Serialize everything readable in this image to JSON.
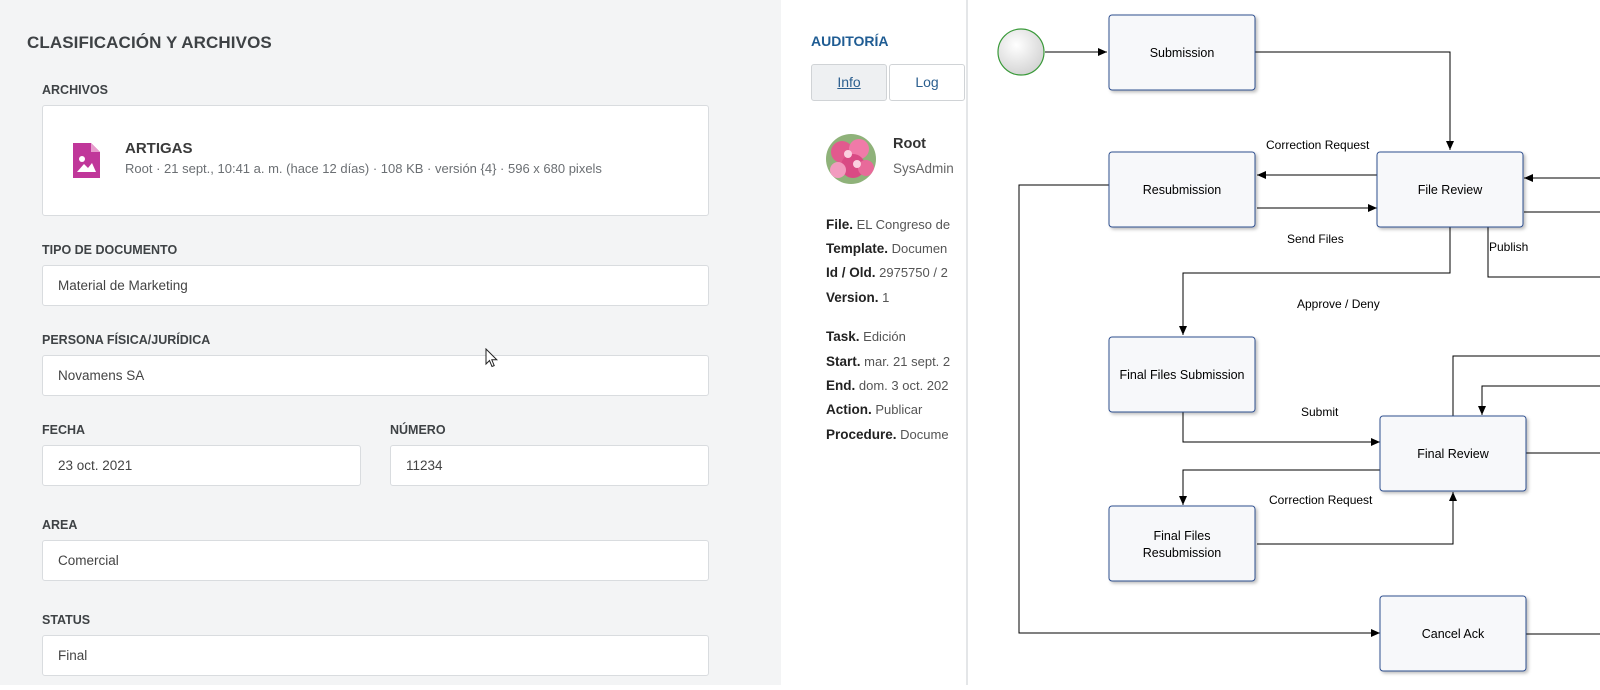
{
  "form": {
    "title": "CLASIFICACIÓN Y ARCHIVOS",
    "files_label": "ARCHIVOS",
    "file": {
      "name": "ARTIGAS",
      "meta": "Root · 21 sept., 10:41 a. m. (hace 12 días) · 108 KB · versión {4} · 596 x 680 pixels"
    },
    "doc_type_label": "TIPO DE DOCUMENTO",
    "doc_type_value": "Material de Marketing",
    "person_label": "PERSONA FÍSICA/JURÍDICA",
    "person_value": "Novamens SA",
    "date_label": "FECHA",
    "date_value": "23 oct. 2021",
    "number_label": "NÚMERO",
    "number_value": "11234",
    "area_label": "AREA",
    "area_value": "Comercial",
    "status_label": "STATUS",
    "status_value": "Final"
  },
  "audit": {
    "title": "AUDITORÍA",
    "tabs": [
      "Info",
      "Log"
    ],
    "user_name": "Root",
    "user_role": "SysAdmin",
    "rows": [
      {
        "key": "File.",
        "value": "EL Congreso de"
      },
      {
        "key": "Template.",
        "value": "Documen"
      },
      {
        "key": "Id / Old.",
        "value": "2975750 / 2"
      },
      {
        "key": "Version.",
        "value": "1"
      },
      {
        "key": "Task.",
        "value": "Edición"
      },
      {
        "key": "Start.",
        "value": "mar. 21 sept. 2"
      },
      {
        "key": "End.",
        "value": "dom. 3 oct. 202"
      },
      {
        "key": "Action.",
        "value": "Publicar"
      },
      {
        "key": "Procedure.",
        "value": "Docume"
      }
    ]
  },
  "workflow": {
    "nodes": {
      "submission": "Submission",
      "resubmission": "Resubmission",
      "file_review": "File Review",
      "final_files_submission": "Final Files Submission",
      "final_review": "Final Review",
      "final_files_resubmission_1": "Final Files",
      "final_files_resubmission_2": "Resubmission",
      "cancel_ack": "Cancel Ack"
    },
    "edges": {
      "correction_request_1": "Correction Request",
      "send_files": "Send Files",
      "publish": "Publish",
      "approve_deny": "Approve / Deny",
      "submit": "Submit",
      "correction_request_2": "Correction Request"
    }
  },
  "colors": {
    "accent": "#1f5c93",
    "file_icon": "#c0379a",
    "node_border": "#2f4f8f",
    "node_fill": "#f7f8fa",
    "start_border": "#3a9a3a"
  }
}
